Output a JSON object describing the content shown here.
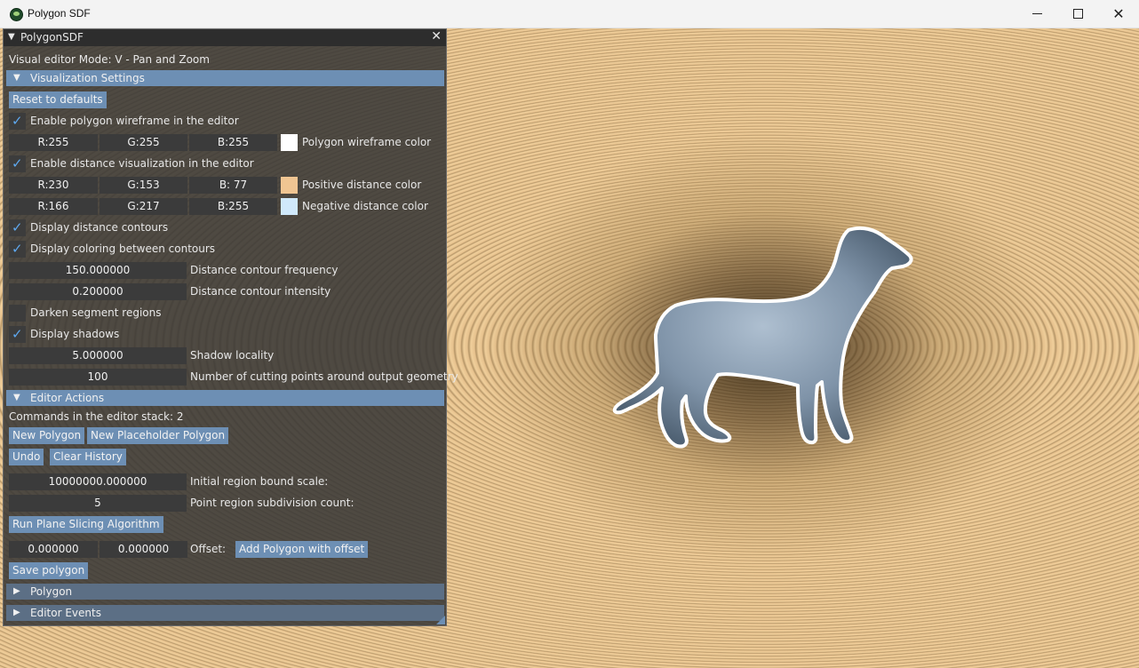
{
  "window": {
    "title": "Polygon SDF"
  },
  "panel": {
    "title": "PolygonSDF",
    "mode_text": "Visual editor Mode:  V - Pan and Zoom",
    "viz": {
      "header": "Visualization Settings",
      "reset": "Reset to defaults",
      "wireframe_enable": "Enable polygon wireframe in the editor",
      "wire_r": "R:255",
      "wire_g": "G:255",
      "wire_b": "B:255",
      "wire_color_label": "Polygon wireframe color",
      "wire_color": "#ffffff",
      "dist_enable": "Enable distance visualization in the editor",
      "pos_r": "R:230",
      "pos_g": "G:153",
      "pos_b": "B: 77",
      "pos_label": "Positive distance color",
      "pos_color": "#e6994d",
      "neg_r": "R:166",
      "neg_g": "G:217",
      "neg_b": "B:255",
      "neg_label": "Negative distance color",
      "neg_color": "#a6d9ff",
      "contours": "Display distance contours",
      "coloring": "Display coloring between contours",
      "freq_value": "150.000000",
      "freq_label": "Distance contour frequency",
      "intensity_value": "0.200000",
      "intensity_label": "Distance contour intensity",
      "darken": "Darken segment regions",
      "shadows": "Display shadows",
      "locality_value": "5.000000",
      "locality_label": "Shadow locality",
      "cutting_value": "100",
      "cutting_label": "Number of cutting points around output geometry"
    },
    "actions": {
      "header": "Editor Actions",
      "commands": "Commands in the editor stack: 2",
      "new_polygon": "New Polygon",
      "new_placeholder": "New Placeholder Polygon",
      "undo": "Undo",
      "clear_history": "Clear History",
      "bound_value": "10000000.000000",
      "bound_label": "Initial region bound scale:",
      "subdiv_value": "5",
      "subdiv_label": "Point region subdivision count:",
      "run_slicing": "Run Plane Slicing Algorithm",
      "offset_x": "0.000000",
      "offset_y": "0.000000",
      "offset_label": "Offset:",
      "add_offset": "Add Polygon with offset",
      "save": "Save polygon"
    },
    "polygon_header": "Polygon",
    "events_header": "Editor Events"
  }
}
